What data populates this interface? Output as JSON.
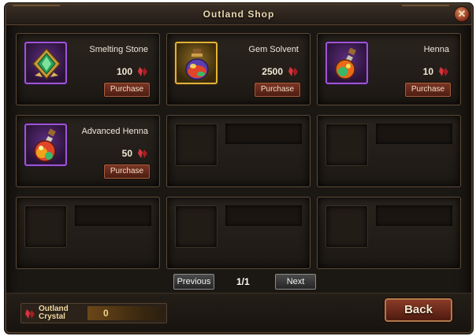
{
  "window": {
    "title": "Outland Shop",
    "close_label": "✕"
  },
  "items": [
    {
      "name": "Smelting Stone",
      "price": "100",
      "button": "Purchase",
      "icon": "green-gem-emblem-icon",
      "rarity": "purple"
    },
    {
      "name": "Gem Solvent",
      "price": "2500",
      "button": "Purchase",
      "icon": "potion-bottle-icon",
      "rarity": "gold"
    },
    {
      "name": "Henna",
      "price": "10",
      "button": "Purchase",
      "icon": "flask-icon",
      "rarity": "purple"
    },
    {
      "name": "Advanced Henna",
      "price": "50",
      "button": "Purchase",
      "icon": "round-flask-icon",
      "rarity": "purple"
    }
  ],
  "pager": {
    "previous_label": "Previous",
    "page": "1/1",
    "next_label": "Next"
  },
  "currency": {
    "label_line1": "Outland",
    "label_line2": "Crystal",
    "value": "0",
    "icon": "red-crystal-icon"
  },
  "back_label": "Back",
  "colors": {
    "rarity_purple": "#9d55d6",
    "rarity_gold": "#e0b23a",
    "crystal_red": "#c8282c",
    "button_red": "#7a3524"
  }
}
